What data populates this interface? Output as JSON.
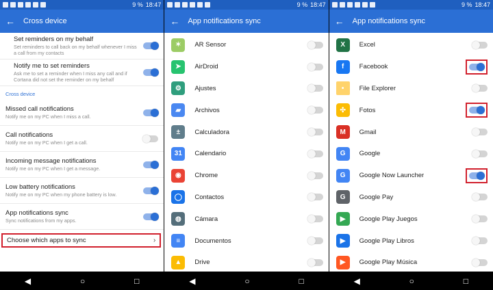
{
  "status": {
    "left_count": 6,
    "right_text": "9 %",
    "time": "18:47"
  },
  "screen1": {
    "title": "Cross device",
    "settings": [
      {
        "title": "Set reminders on my behalf",
        "sub": "Set reminders to call back on my behalf whenever I miss a call from my contacts",
        "toggle": "on"
      },
      {
        "title": "Notify me to set reminders",
        "sub": "Ask me to set a reminder when I miss any call and if Cortana did not set the reminder on my behalf",
        "toggle": "on"
      }
    ],
    "section_title": "Cross device",
    "settings2": [
      {
        "title": "Missed call notifications",
        "sub": "Notify me on my PC when I miss a call.",
        "toggle": "on"
      },
      {
        "title": "Call notifications",
        "sub": "Notify me on my PC when I get a call.",
        "toggle": "off"
      },
      {
        "title": "Incoming message notifications",
        "sub": "Notify me on my PC when I get a message.",
        "toggle": "on"
      },
      {
        "title": "Low battery notifications",
        "sub": "Notify me on my PC when my phone battery is low.",
        "toggle": "on"
      },
      {
        "title": "App notifications sync",
        "sub": "Sync notifications from my apps.",
        "toggle": "on"
      }
    ],
    "choose_label": "Choose which apps to sync"
  },
  "screen2": {
    "title": "App notifications sync",
    "apps": [
      {
        "name": "AR Sensor",
        "icon": "ar-sensor-icon",
        "color": "#9ccc65"
      },
      {
        "name": "AirDroid",
        "icon": "airdroid-icon",
        "color": "#27c36f"
      },
      {
        "name": "Ajustes",
        "icon": "settings-icon",
        "color": "#2f9e7d"
      },
      {
        "name": "Archivos",
        "icon": "files-icon",
        "color": "#4a88f1"
      },
      {
        "name": "Calculadora",
        "icon": "calculator-icon",
        "color": "#607d8b"
      },
      {
        "name": "Calendario",
        "icon": "calendar-icon",
        "color": "#4285f4"
      },
      {
        "name": "Chrome",
        "icon": "chrome-icon",
        "color": "#ea4335"
      },
      {
        "name": "Contactos",
        "icon": "contacts-icon",
        "color": "#1a73e8"
      },
      {
        "name": "Cámara",
        "icon": "camera-icon",
        "color": "#546e7a"
      },
      {
        "name": "Documentos",
        "icon": "docs-icon",
        "color": "#4285f4"
      },
      {
        "name": "Drive",
        "icon": "drive-icon",
        "color": "#fbbc04"
      }
    ]
  },
  "screen3": {
    "title": "App notifications sync",
    "apps": [
      {
        "name": "Excel",
        "icon": "excel-icon",
        "color": "#217346",
        "toggle": "off"
      },
      {
        "name": "Facebook",
        "icon": "facebook-icon",
        "color": "#1877f2",
        "toggle": "on",
        "highlight": true
      },
      {
        "name": "File Explorer",
        "icon": "folder-icon",
        "color": "#ffd36b",
        "toggle": "off"
      },
      {
        "name": "Fotos",
        "icon": "photos-icon",
        "color": "#fbbc04",
        "toggle": "on",
        "highlight": true
      },
      {
        "name": "Gmail",
        "icon": "gmail-icon",
        "color": "#d93025",
        "toggle": "off"
      },
      {
        "name": "Google",
        "icon": "google-icon",
        "color": "#4285f4",
        "toggle": "off"
      },
      {
        "name": "Google Now Launcher",
        "icon": "google-now-launcher-icon",
        "color": "#4285f4",
        "toggle": "on",
        "highlight": true
      },
      {
        "name": "Google Pay",
        "icon": "google-pay-icon",
        "color": "#5f6368",
        "toggle": "off"
      },
      {
        "name": "Google Play Juegos",
        "icon": "play-games-icon",
        "color": "#34a853",
        "toggle": "off"
      },
      {
        "name": "Google Play Libros",
        "icon": "play-books-icon",
        "color": "#1a73e8",
        "toggle": "off"
      },
      {
        "name": "Google Play Música",
        "icon": "play-music-icon",
        "color": "#ff5722",
        "toggle": "off"
      }
    ]
  }
}
